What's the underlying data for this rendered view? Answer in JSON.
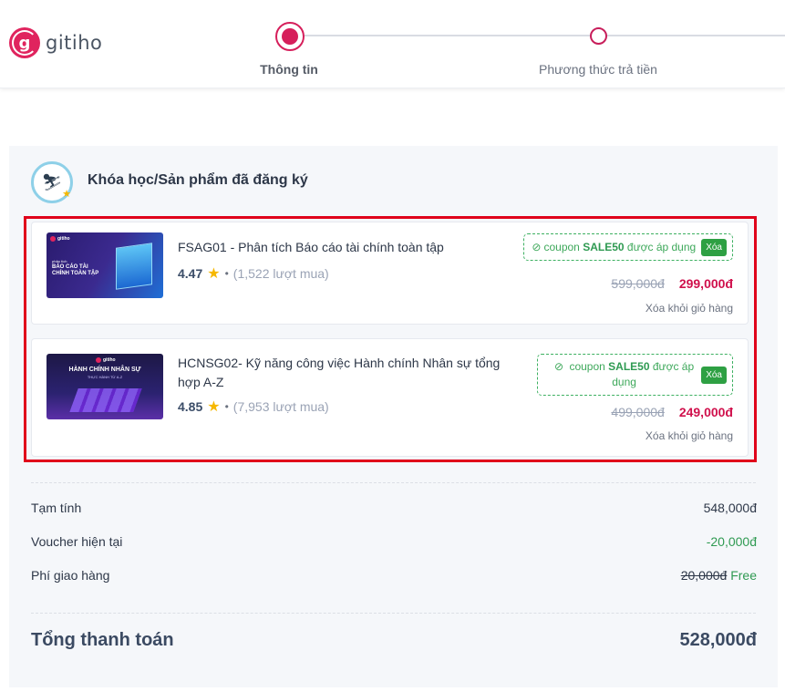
{
  "brand": {
    "logo_letter": "g",
    "name": "gitiho"
  },
  "stepper": {
    "steps": [
      {
        "label": "Thông tin",
        "active": true
      },
      {
        "label": "Phương thức trả tiền",
        "active": false
      }
    ]
  },
  "section": {
    "title": "Khóa học/Sản phẩm đã đăng ký",
    "icon": "course-icon"
  },
  "courses": [
    {
      "code_title": "FSAG01 - Phân tích Báo cáo tài chính toàn tập",
      "rating": "4.47",
      "purchases": "(1,522 lượt mua)",
      "thumbnail": {
        "brand": "gitiho",
        "small": "phân tích",
        "text": "BÁO CÁO TÀI CHÍNH TOÀN TẬP"
      },
      "coupon": {
        "prefix": "coupon",
        "code": "SALE50",
        "suffix": "được áp dụng",
        "button": "Xóa"
      },
      "old_price": "599,000đ",
      "new_price": "299,000đ",
      "remove": "Xóa khỏi giỏ hàng"
    },
    {
      "code_title": "HCNSG02- Kỹ năng công việc Hành chính Nhân sự tổng hợp A-Z",
      "rating": "4.85",
      "purchases": "(7,953 lượt mua)",
      "thumbnail": {
        "brand": "gitiho",
        "text": "HÀNH CHÍNH NHÂN SỰ",
        "small": "THỰC HÀNH TỪ A-Z"
      },
      "coupon": {
        "prefix": "coupon",
        "code": "SALE50",
        "suffix": "được áp dụng",
        "button": "Xóa"
      },
      "old_price": "499,000đ",
      "new_price": "249,000đ",
      "remove": "Xóa khỏi giỏ hàng"
    }
  ],
  "summary": {
    "subtotal_label": "Tạm tính",
    "subtotal_value": "548,000đ",
    "voucher_label": "Voucher hiện tại",
    "voucher_value": "-20,000đ",
    "shipping_label": "Phí giao hàng",
    "shipping_old": "20,000đ",
    "shipping_value": "Free",
    "total_label": "Tổng thanh toán",
    "total_value": "528,000đ"
  },
  "colors": {
    "accent": "#d61f5b",
    "price": "#d0104c",
    "coupon": "#2ea043",
    "highlight": "#e0001a"
  }
}
